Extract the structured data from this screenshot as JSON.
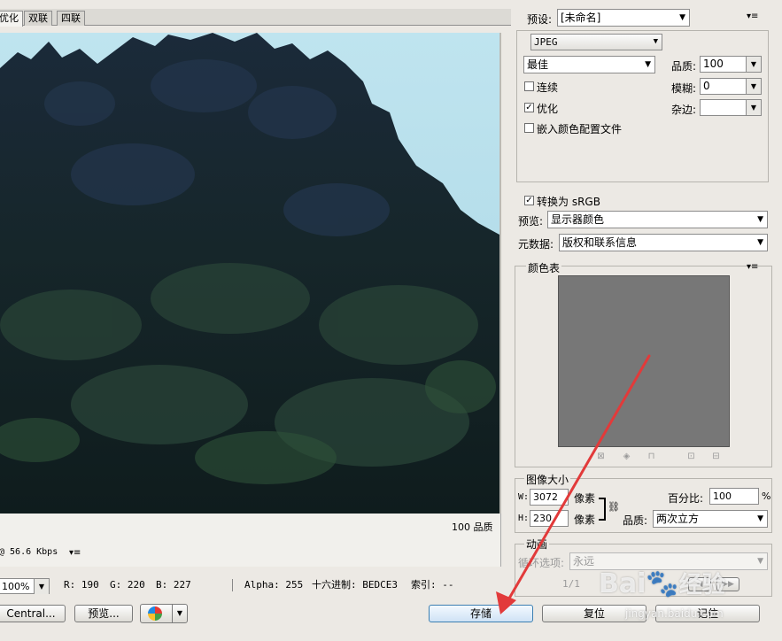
{
  "tabs": [
    "优化",
    "双联",
    "四联"
  ],
  "preview": {
    "quality_label": "100 品质",
    "speed_label": "@ 56.6 Kbps"
  },
  "status_bar": {
    "zoom": "100%",
    "r": "R: 190",
    "g": "G: 220",
    "b": "B: 227",
    "alpha": "Alpha: 255",
    "hex": "十六进制: BEDCE3",
    "index": "索引: --",
    "frame_counter": "1/1"
  },
  "bottom_buttons": {
    "device_central": "Central...",
    "preview": "预览...",
    "save": "存储",
    "reset": "复位",
    "remember": "记住"
  },
  "settings": {
    "preset_label": "预设:",
    "preset_value": "[未命名]",
    "format": "JPEG",
    "quality_preset": "最佳",
    "quality_label": "品质:",
    "quality_value": "100",
    "progressive_label": "连续",
    "progressive_checked": false,
    "blur_label": "模糊:",
    "blur_value": "0",
    "optimized_label": "优化",
    "optimized_checked": true,
    "matte_label": "杂边:",
    "matte_value": "",
    "embed_profile_label": "嵌入颜色配置文件",
    "embed_profile_checked": false,
    "convert_srgb_label": "转换为 sRGB",
    "convert_srgb_checked": true,
    "preview_label": "预览:",
    "preview_value": "显示器颜色",
    "metadata_label": "元数据:",
    "metadata_value": "版权和联系信息"
  },
  "color_table": {
    "title": "颜色表",
    "swatch_color": "#777777"
  },
  "image_size": {
    "title": "图像大小",
    "w_label": "W:",
    "w_value": "3072",
    "h_label": "H:",
    "h_value": "230",
    "unit": "像素",
    "percent_label": "百分比:",
    "percent_value": "100",
    "percent_unit": "%",
    "quality_label": "品质:",
    "quality_value": "两次立方"
  },
  "animation": {
    "title": "动画",
    "loop_label": "循环选项:",
    "loop_value": "永远"
  },
  "watermark": {
    "brand": "Bai",
    "brand_suffix": "经验",
    "url": "jingyan.baidu.com"
  }
}
